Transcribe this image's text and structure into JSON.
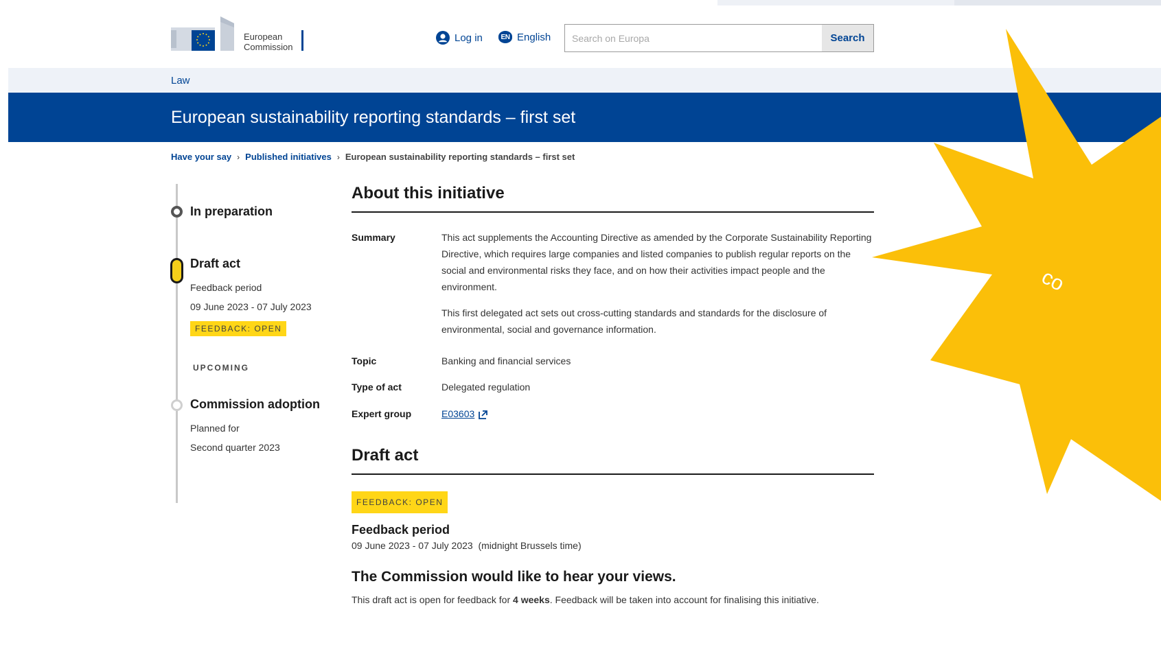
{
  "header": {
    "logo_line1": "European",
    "logo_line2": "Commission",
    "login_label": "Log in",
    "lang_code": "EN",
    "lang_label": "English",
    "search_placeholder": "Search on Europa",
    "search_button": "Search"
  },
  "site_section": "Law",
  "page_title": "European sustainability reporting standards – first set",
  "breadcrumb": {
    "item1": "Have your say",
    "item2": "Published initiatives",
    "current": "European sustainability reporting standards – first set"
  },
  "timeline": {
    "stage1_title": "In preparation",
    "stage2_title": "Draft act",
    "stage2_sub": "Feedback period",
    "stage2_dates": "09 June 2023 - 07 July 2023",
    "stage2_badge": "FEEDBACK: OPEN",
    "upcoming_label": "UPCOMING",
    "stage3_title": "Commission adoption",
    "stage3_sub": "Planned for",
    "stage3_date": "Second quarter 2023"
  },
  "about": {
    "title": "About this initiative",
    "summary_label": "Summary",
    "summary_p1": "This act supplements the Accounting Directive as amended by the Corporate Sustainability Reporting Directive, which requires large companies and listed companies to publish regular reports on the social and environmental risks they face, and on how their activities impact people and the environment.",
    "summary_p2": "This first delegated act sets out cross-cutting standards and standards for the disclosure of environmental, social and governance information.",
    "topic_label": "Topic",
    "topic_value": "Banking and financial services",
    "type_label": "Type of act",
    "type_value": "Delegated regulation",
    "expert_label": "Expert group",
    "expert_value": "E03603"
  },
  "draft": {
    "title": "Draft act",
    "badge": "FEEDBACK: OPEN",
    "period_label": "Feedback period",
    "period_value": "09 June 2023 - 07 July 2023  (midnight Brussels time)",
    "views_title": "The Commission would like to hear your views.",
    "views_pre": "This draft act is open for feedback for ",
    "views_bold": "4 weeks",
    "views_post": ". Feedback will be taken into account for finalising this initiative."
  },
  "starburst_text": "co",
  "colors": {
    "brand_blue": "#004494",
    "badge_yellow": "#ffd617",
    "starburst_yellow": "#fbbf09"
  }
}
